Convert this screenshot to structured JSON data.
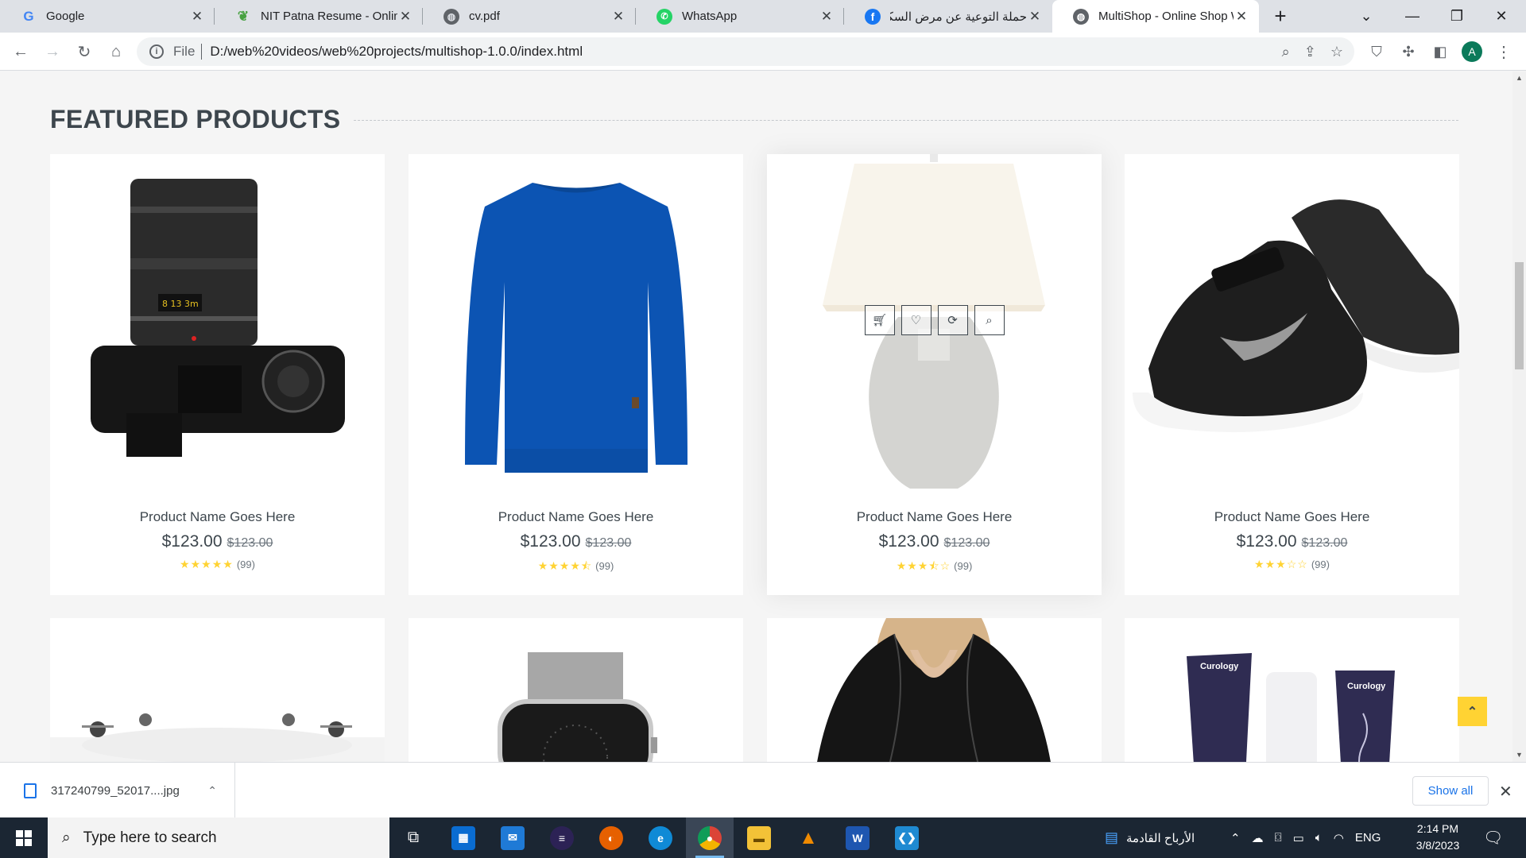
{
  "browser": {
    "tabs": [
      {
        "title": "Google",
        "icon": "google-icon",
        "active": false
      },
      {
        "title": "NIT Patna Resume - Online",
        "icon": "overleaf-icon",
        "active": false
      },
      {
        "title": "cv.pdf",
        "icon": "globe-icon",
        "active": false
      },
      {
        "title": "WhatsApp",
        "icon": "whatsapp-icon",
        "active": false
      },
      {
        "title": "حملة التوعية عن مرض السكر",
        "icon": "facebook-icon",
        "active": false
      },
      {
        "title": "MultiShop - Online Shop W",
        "icon": "globe-icon",
        "active": true
      }
    ],
    "address": {
      "scheme_label": "File",
      "url": "D:/web%20videos/web%20projects/multishop-1.0.0/index.html"
    },
    "profile_initial": "A"
  },
  "page": {
    "section_title": "FEATURED PRODUCTS",
    "products": [
      {
        "name": "Product Name Goes Here",
        "price": "$123.00",
        "old_price": "$123.00",
        "stars": "★★★★★",
        "reviews": "(99)",
        "image": "camera"
      },
      {
        "name": "Product Name Goes Here",
        "price": "$123.00",
        "old_price": "$123.00",
        "stars": "★★★★⯪",
        "reviews": "(99)",
        "image": "sweater"
      },
      {
        "name": "Product Name Goes Here",
        "price": "$123.00",
        "old_price": "$123.00",
        "stars": "★★★⯪☆",
        "reviews": "(99)",
        "image": "lamp"
      },
      {
        "name": "Product Name Goes Here",
        "price": "$123.00",
        "old_price": "$123.00",
        "stars": "★★★☆☆",
        "reviews": "(99)",
        "image": "shoes"
      }
    ],
    "second_row": [
      {
        "image": "drone"
      },
      {
        "image": "watch"
      },
      {
        "image": "blouse"
      },
      {
        "image": "curology",
        "brand_text": "Curology"
      }
    ],
    "accent_color": "#ffd333"
  },
  "downloads": {
    "file_name": "317240799_52017....jpg",
    "show_all_label": "Show all"
  },
  "taskbar": {
    "search_placeholder": "Type here to search",
    "news_text": "الأرباح القادمة",
    "language": "ENG",
    "time": "2:14 PM",
    "date": "3/8/2023"
  }
}
